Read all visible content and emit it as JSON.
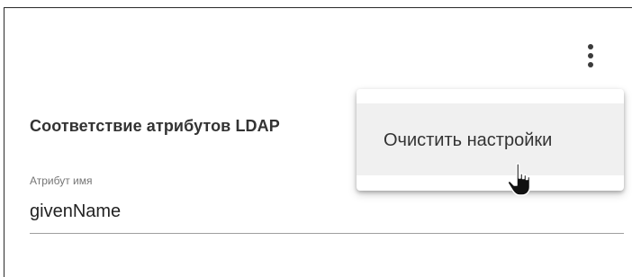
{
  "section": {
    "title": "Соответствие атрибутов LDAP"
  },
  "field": {
    "label": "Атрибут имя",
    "value": "givenName"
  },
  "menu": {
    "items": [
      {
        "label": "Очистить настройки"
      }
    ]
  },
  "icons": {
    "more": "more-vert-icon",
    "cursor": "hand-pointer-cursor-icon"
  }
}
